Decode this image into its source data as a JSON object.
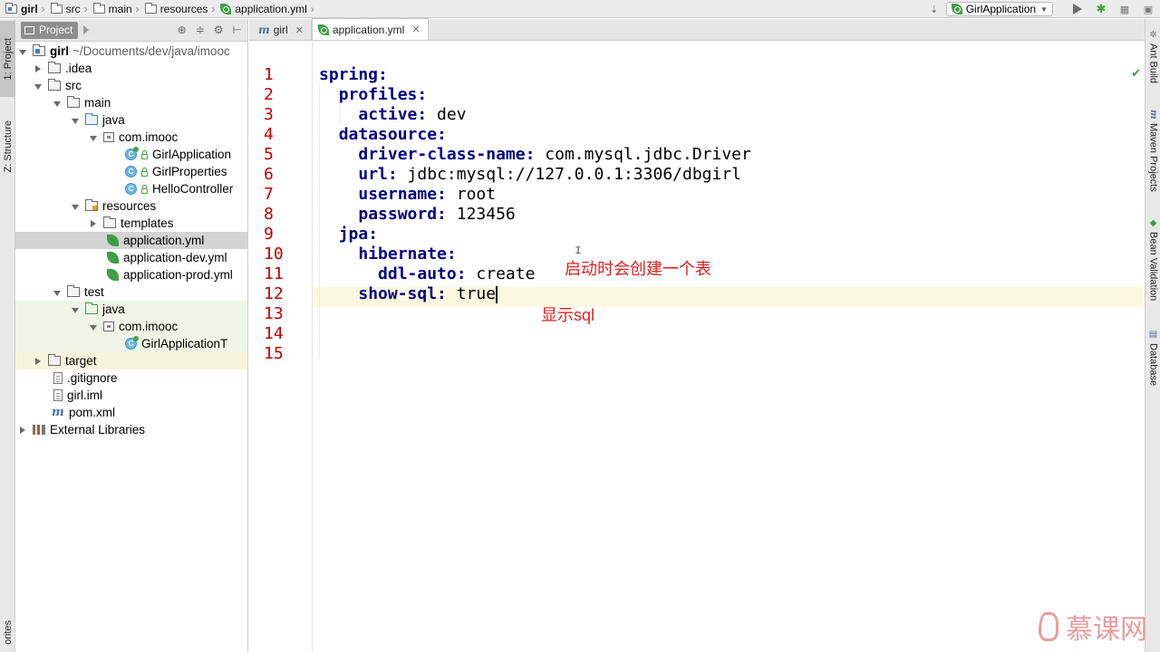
{
  "breadcrumb": [
    "girl",
    "src",
    "main",
    "resources",
    "application.yml"
  ],
  "toolbar": {
    "run_config": "GirlApplication"
  },
  "left_strip": {
    "project_tab": "1: Project",
    "structure_tab": "Z: Structure",
    "favorites_tab": "orites"
  },
  "project_panel": {
    "title": "Project",
    "root_name": "girl",
    "root_path": "~/Documents/dev/java/imooc",
    "items": [
      ".idea",
      "src",
      "main",
      "java",
      "com.imooc",
      "GirlApplication",
      "GirlProperties",
      "HelloController",
      "resources",
      "templates",
      "application.yml",
      "application-dev.yml",
      "application-prod.yml",
      "test",
      "java",
      "com.imooc",
      "GirlApplicationT",
      "target",
      ".gitignore",
      "girl.iml",
      "pom.xml",
      "External Libraries"
    ]
  },
  "editor": {
    "tabs": [
      {
        "label": "girl",
        "icon": "maven-icon"
      },
      {
        "label": "application.yml",
        "icon": "spring-yml-icon"
      }
    ],
    "line_numbers": [
      "1",
      "2",
      "3",
      "4",
      "5",
      "6",
      "7",
      "8",
      "9",
      "10",
      "11",
      "12",
      "13",
      "14",
      "15"
    ],
    "lines": [
      {
        "key": "spring:",
        "value": ""
      },
      {
        "key": "profiles:",
        "value": ""
      },
      {
        "key": "active:",
        "value": " dev"
      },
      {
        "key": "datasource:",
        "value": ""
      },
      {
        "key": "driver-class-name:",
        "value": " com.mysql.jdbc.Driver"
      },
      {
        "key": "url:",
        "value": " jdbc:mysql://127.0.0.1:3306/dbgirl"
      },
      {
        "key": "username:",
        "value": " root"
      },
      {
        "key": "password:",
        "value": " 123456"
      },
      {
        "key": "jpa:",
        "value": ""
      },
      {
        "key": "hibernate:",
        "value": ""
      },
      {
        "key": "ddl-auto:",
        "value": " create"
      },
      {
        "key": "show-sql:",
        "value": " true"
      }
    ],
    "annotations": {
      "ddl_auto_note": "启动时会创建一个表",
      "show_sql_note": "显示sql"
    }
  },
  "right_strip": {
    "ant_build": "Ant Build",
    "maven_projects": "Maven Projects",
    "bean_validation": "Bean Validation",
    "database": "Database"
  },
  "watermark": {
    "text": "慕课网"
  },
  "colors": {
    "line_number": "#c00000",
    "yaml_key": "#000080",
    "annotation": "#e61e1e",
    "current_line": "#fbf8e0"
  }
}
